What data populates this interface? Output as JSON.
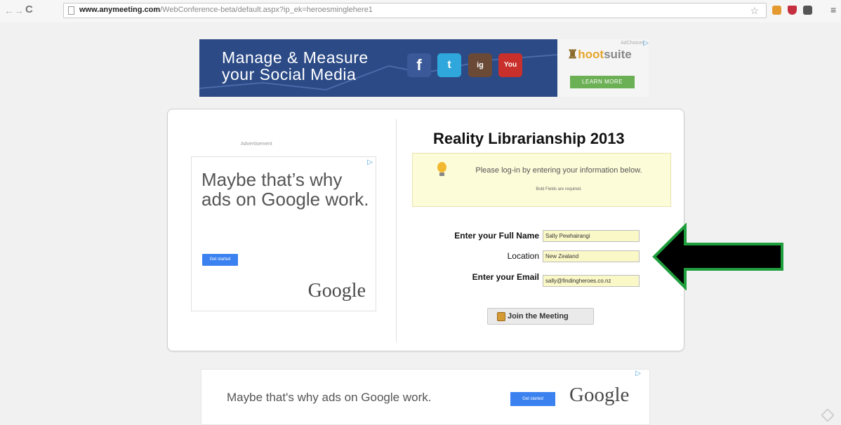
{
  "browser": {
    "url_domain": "www.anymeeting.com",
    "url_path": "/WebConference-beta/default.aspx?ip_ek=heroesminglehere1",
    "nav": {
      "back": "←",
      "forward": "→",
      "reload": "C"
    }
  },
  "banner_ad": {
    "line1": "Manage & Measure",
    "line2": "your Social Media",
    "social_icons": [
      "f",
      "t",
      "ig",
      "You"
    ],
    "adchoices": "AdChoices",
    "brand_hoot": "hoot",
    "brand_suite": "suite",
    "cta": "LEARN MORE"
  },
  "side_ad": {
    "label": "Advertisement",
    "headline": "Maybe that’s why ads on Google work.",
    "button": "Get started",
    "brand": "Google"
  },
  "form": {
    "title": "Reality Librarianship 2013",
    "info_text": "Please log-in by entering your information below.",
    "info_note": "Bold Fields are required.",
    "fields": [
      {
        "label": "Enter your Full Name",
        "value": "Sally Pewhairangi"
      },
      {
        "label": "Location",
        "value": "New Zealand"
      },
      {
        "label": "Enter your Email",
        "value": "sally@findingheroes.co.nz"
      }
    ],
    "join_button": "Join the Meeting"
  },
  "bottom_ad": {
    "text": "Maybe that's why ads on Google work.",
    "button": "Get started",
    "brand": "Google"
  },
  "colors": {
    "arrow_fill": "#000000",
    "arrow_stroke": "#1f9e3d",
    "banner_bg": "#2b4a86",
    "input_bg": "#fbf8c8"
  }
}
